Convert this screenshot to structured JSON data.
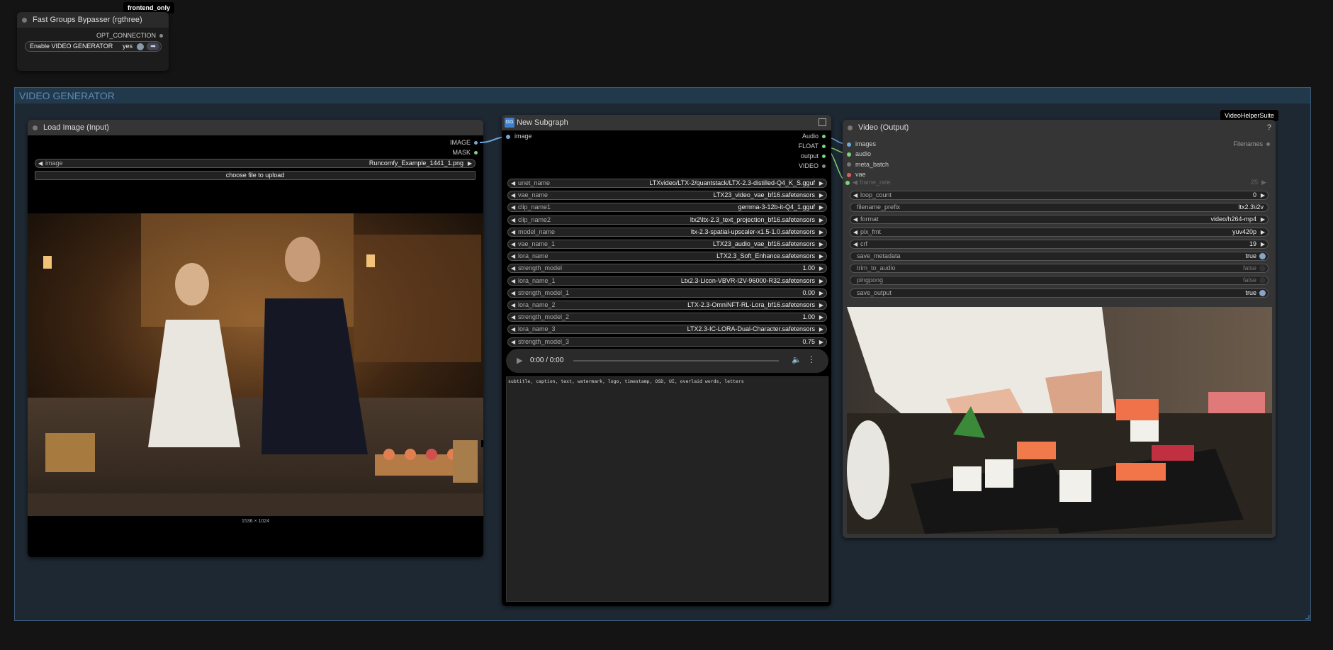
{
  "frontend_tag": "frontend_only",
  "bypasser": {
    "title": "Fast Groups Bypasser (rgthree)",
    "output": "OPT_CONNECTION",
    "toggle_label": "Enable VIDEO GENERATOR",
    "toggle_value": "yes"
  },
  "group": {
    "title": "VIDEO GENERATOR",
    "color": "#223445"
  },
  "load_image": {
    "title": "Load Image (Input)",
    "outputs": [
      "IMAGE",
      "MASK"
    ],
    "image_label": "image",
    "image_value": "Runcomfy_Example_1441_1.png",
    "upload_label": "choose file to upload",
    "dimensions": "1536 × 1024"
  },
  "subgraph": {
    "badge": "GG",
    "title": "New Subgraph",
    "input": "image",
    "outputs": [
      "Audio",
      "FLOAT",
      "output",
      "VIDEO"
    ],
    "widgets": [
      {
        "label": "unet_name",
        "value": "LTXvideo/LTX-2/quantstack/LTX-2.3-distilled-Q4_K_S.gguf"
      },
      {
        "label": "vae_name",
        "value": "LTX23_video_vae_bf16.safetensors"
      },
      {
        "label": "clip_name1",
        "value": "gemma-3-12b-it-Q4_1.gguf"
      },
      {
        "label": "clip_name2",
        "value": "ltx2\\ltx-2.3_text_projection_bf16.safetensors"
      },
      {
        "label": "model_name",
        "value": "ltx-2.3-spatial-upscaler-x1.5-1.0.safetensors"
      },
      {
        "label": "vae_name_1",
        "value": "LTX23_audio_vae_bf16.safetensors"
      },
      {
        "label": "lora_name",
        "value": "LTX2.3_Soft_Enhance.safetensors"
      },
      {
        "label": "strength_model",
        "value": "1.00"
      },
      {
        "label": "lora_name_1",
        "value": "Ltx2.3-Licon-VBVR-I2V-96000-R32.safetensors"
      },
      {
        "label": "strength_model_1",
        "value": "0.00"
      },
      {
        "label": "lora_name_2",
        "value": "LTX-2.3-OmniNFT-RL-Lora_bf16.safetensors"
      },
      {
        "label": "strength_model_2",
        "value": "1.00"
      },
      {
        "label": "lora_name_3",
        "value": "LTX2.3-IC-LORA-Dual-Character.safetensors"
      },
      {
        "label": "strength_model_3",
        "value": "0.75"
      }
    ],
    "audio_time": "0:00 / 0:00",
    "negative_prompt": "subtitle, caption, text, watermark, logo, timestamp, OSD, UI, overlaid words, letters"
  },
  "video_output": {
    "suite_tag": "VideoHelperSuite",
    "title": "Video (Output)",
    "help": "?",
    "inputs": [
      {
        "label": "images",
        "color": "#6fa8dc"
      },
      {
        "label": "audio",
        "color": "#7bd37b"
      },
      {
        "label": "meta_batch",
        "color": "#777777"
      },
      {
        "label": "vae",
        "color": "#e06060"
      }
    ],
    "output": "Filenames",
    "frame_rate_label": "frame_rate",
    "frame_rate_value": "25",
    "widgets": [
      {
        "label": "loop_count",
        "value": "0",
        "kind": "num"
      },
      {
        "label": "filename_prefix",
        "value": "ltx2.3\\i2v",
        "kind": "text"
      },
      {
        "label": "format",
        "value": "video/h264-mp4",
        "kind": "num"
      },
      {
        "label": "pix_fmt",
        "value": "yuv420p",
        "kind": "num"
      },
      {
        "label": "crf",
        "value": "19",
        "kind": "num"
      },
      {
        "label": "save_metadata",
        "value": "true",
        "kind": "toggle",
        "on": true
      },
      {
        "label": "trim_to_audio",
        "value": "false",
        "kind": "toggle",
        "on": false
      },
      {
        "label": "pingpong",
        "value": "false",
        "kind": "toggle",
        "on": false
      },
      {
        "label": "save_output",
        "value": "true",
        "kind": "toggle",
        "on": true
      }
    ]
  }
}
